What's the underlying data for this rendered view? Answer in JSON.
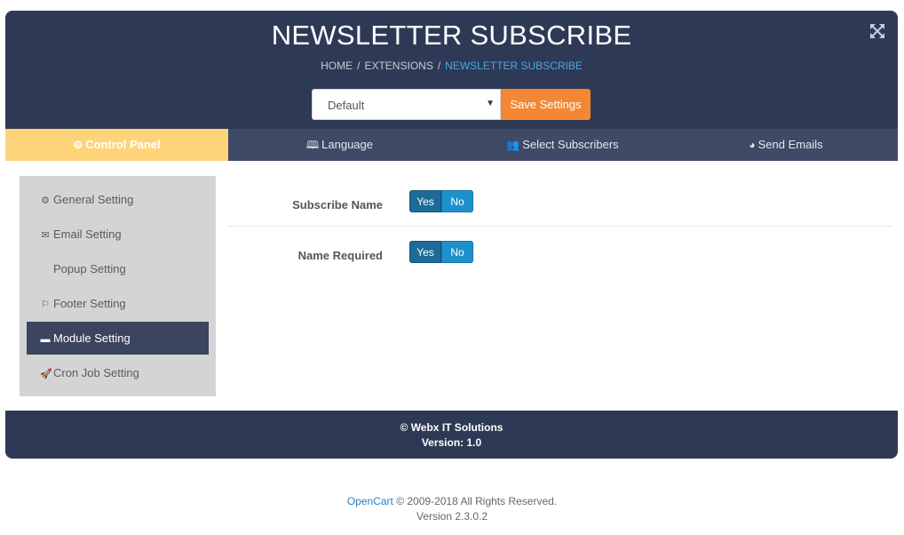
{
  "header": {
    "title": "NEWSLETTER SUBSCRIBE",
    "breadcrumb": [
      "HOME",
      "EXTENSIONS",
      "NEWSLETTER SUBSCRIBE"
    ],
    "breadcrumb_separator": "/",
    "store_select": {
      "selected": "Default",
      "caret": "▼"
    },
    "save_label": "Save Settings",
    "expand_icon": "expand-arrows-icon"
  },
  "tabs": [
    {
      "label": "Control Panel",
      "icon": "gear-icon",
      "glyph": "⚙",
      "active": true
    },
    {
      "label": "Language",
      "icon": "language-icon",
      "glyph": "🕮",
      "active": false
    },
    {
      "label": "Select Subscribers",
      "icon": "users-icon",
      "glyph": "👥",
      "active": false
    },
    {
      "label": "Send Emails",
      "icon": "dashboard-icon",
      "glyph": "◕",
      "active": false
    }
  ],
  "sidebar": {
    "items": [
      {
        "label": "General Setting",
        "icon": "gear-icon",
        "glyph": "⚙",
        "active": false
      },
      {
        "label": "Email Setting",
        "icon": "envelope-icon",
        "glyph": "✉",
        "active": false
      },
      {
        "label": "Popup Setting",
        "icon": "",
        "glyph": "",
        "active": false
      },
      {
        "label": "Footer Setting",
        "icon": "flag-icon",
        "glyph": "⚐",
        "active": false
      },
      {
        "label": "Module Setting",
        "icon": "folder-icon",
        "glyph": "▬",
        "active": true
      },
      {
        "label": "Cron Job Setting",
        "icon": "rocket-icon",
        "glyph": "🚀",
        "active": false
      }
    ]
  },
  "form": {
    "rows": [
      {
        "label": "Subscribe Name",
        "yes": "Yes",
        "no": "No",
        "value": "Yes"
      },
      {
        "label": "Name Required",
        "yes": "Yes",
        "no": "No",
        "value": "Yes"
      }
    ]
  },
  "footer": {
    "copyright": "© Webx IT Solutions",
    "version": "Version: 1.0"
  },
  "page_footer": {
    "link": "OpenCart",
    "rights": " © 2009-2018 All Rights Reserved.",
    "version": "Version 2.3.0.2"
  },
  "colors": {
    "header_bg": "#2e3a55",
    "tab_bar_bg": "#3e4a66",
    "active_tab": "#fdd479",
    "save_button": "#f38733",
    "breadcrumb_active": "#4aa8e6",
    "toggle_on": "#1d6b99",
    "toggle_off": "#1e90cc",
    "sidebar_bg": "#d4d4d4",
    "sidebar_active": "#3b4560"
  }
}
